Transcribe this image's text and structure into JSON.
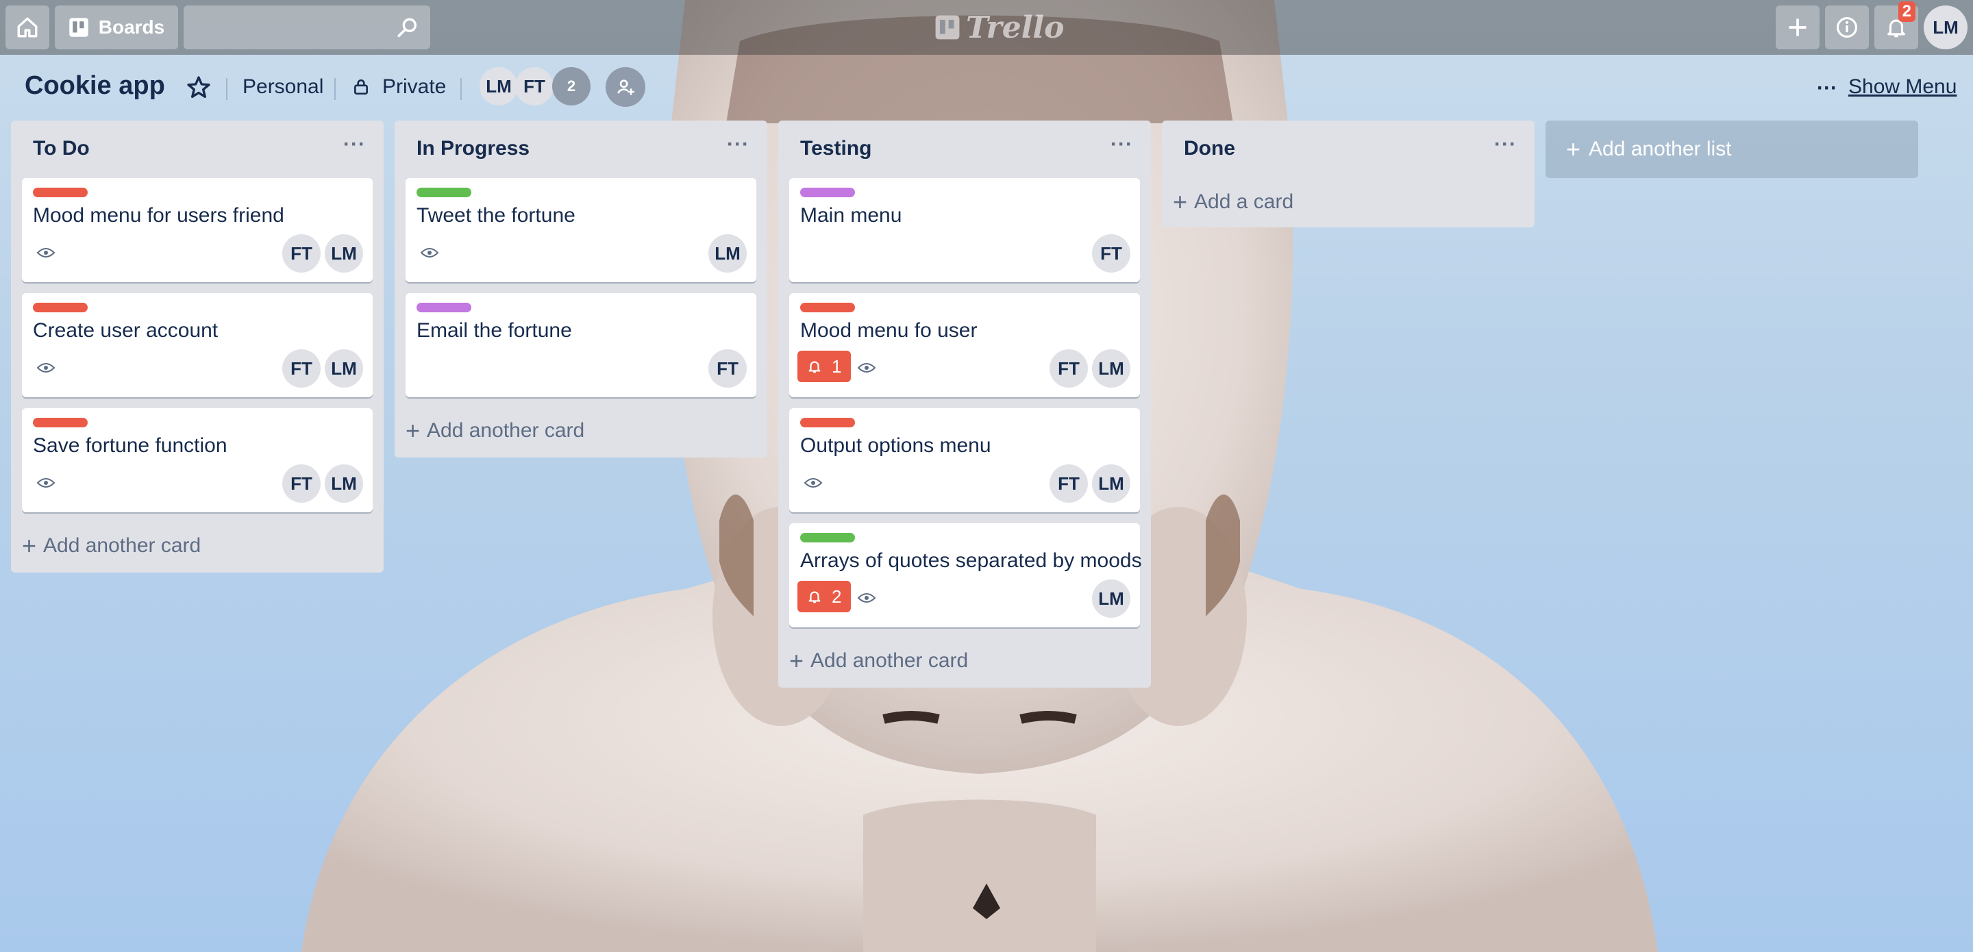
{
  "header": {
    "boards_label": "Boards",
    "search_value": "",
    "logo_text": "Trello",
    "notification_count": "2",
    "user_initials": "LM"
  },
  "board": {
    "title": "Cookie app",
    "visibility_team": "Personal",
    "visibility_privacy": "Private",
    "members": [
      "LM",
      "FT"
    ],
    "extra_members": "2",
    "show_menu_label": "Show Menu"
  },
  "lists": [
    {
      "title": "To Do",
      "cards": [
        {
          "title": "Mood menu for users friend",
          "label_color": "#eb5a46",
          "notifications": "",
          "members": [
            "FT",
            "LM"
          ]
        },
        {
          "title": "Create user account",
          "label_color": "#eb5a46",
          "notifications": "",
          "members": [
            "FT",
            "LM"
          ]
        },
        {
          "title": "Save fortune function",
          "label_color": "#eb5a46",
          "notifications": "",
          "members": [
            "FT",
            "LM"
          ]
        }
      ],
      "add_label": "Add another card"
    },
    {
      "title": "In Progress",
      "cards": [
        {
          "title": "Tweet the fortune",
          "label_color": "#61bd4f",
          "notifications": "",
          "members": [
            "LM"
          ]
        },
        {
          "title": "Email the fortune",
          "label_color": "#c377e0",
          "notifications": "",
          "members": [
            "FT"
          ]
        }
      ],
      "add_label": "Add another card"
    },
    {
      "title": "Testing",
      "cards": [
        {
          "title": "Main menu",
          "label_color": "#c377e0",
          "notifications": "",
          "members": [
            "FT"
          ]
        },
        {
          "title": "Mood menu fo user",
          "label_color": "#eb5a46",
          "notifications": "1",
          "members": [
            "FT",
            "LM"
          ]
        },
        {
          "title": "Output options menu",
          "label_color": "#eb5a46",
          "notifications": "",
          "members": [
            "FT",
            "LM"
          ]
        },
        {
          "title": "Arrays of quotes separated by moods",
          "label_color": "#61bd4f",
          "notifications": "2",
          "members": [
            "LM"
          ]
        }
      ],
      "add_label": "Add another card"
    },
    {
      "title": "Done",
      "cards": [],
      "add_label": "Add a card"
    }
  ],
  "add_list_label": "Add another list",
  "icons": {
    "home": "home-icon",
    "boards": "boards-icon",
    "search": "search-icon",
    "plus": "plus-icon",
    "info": "info-icon",
    "bell": "bell-icon",
    "star": "star-icon",
    "lock": "lock-icon",
    "eye": "eye-icon",
    "invite": "add-member-icon",
    "more": "more-icon"
  }
}
